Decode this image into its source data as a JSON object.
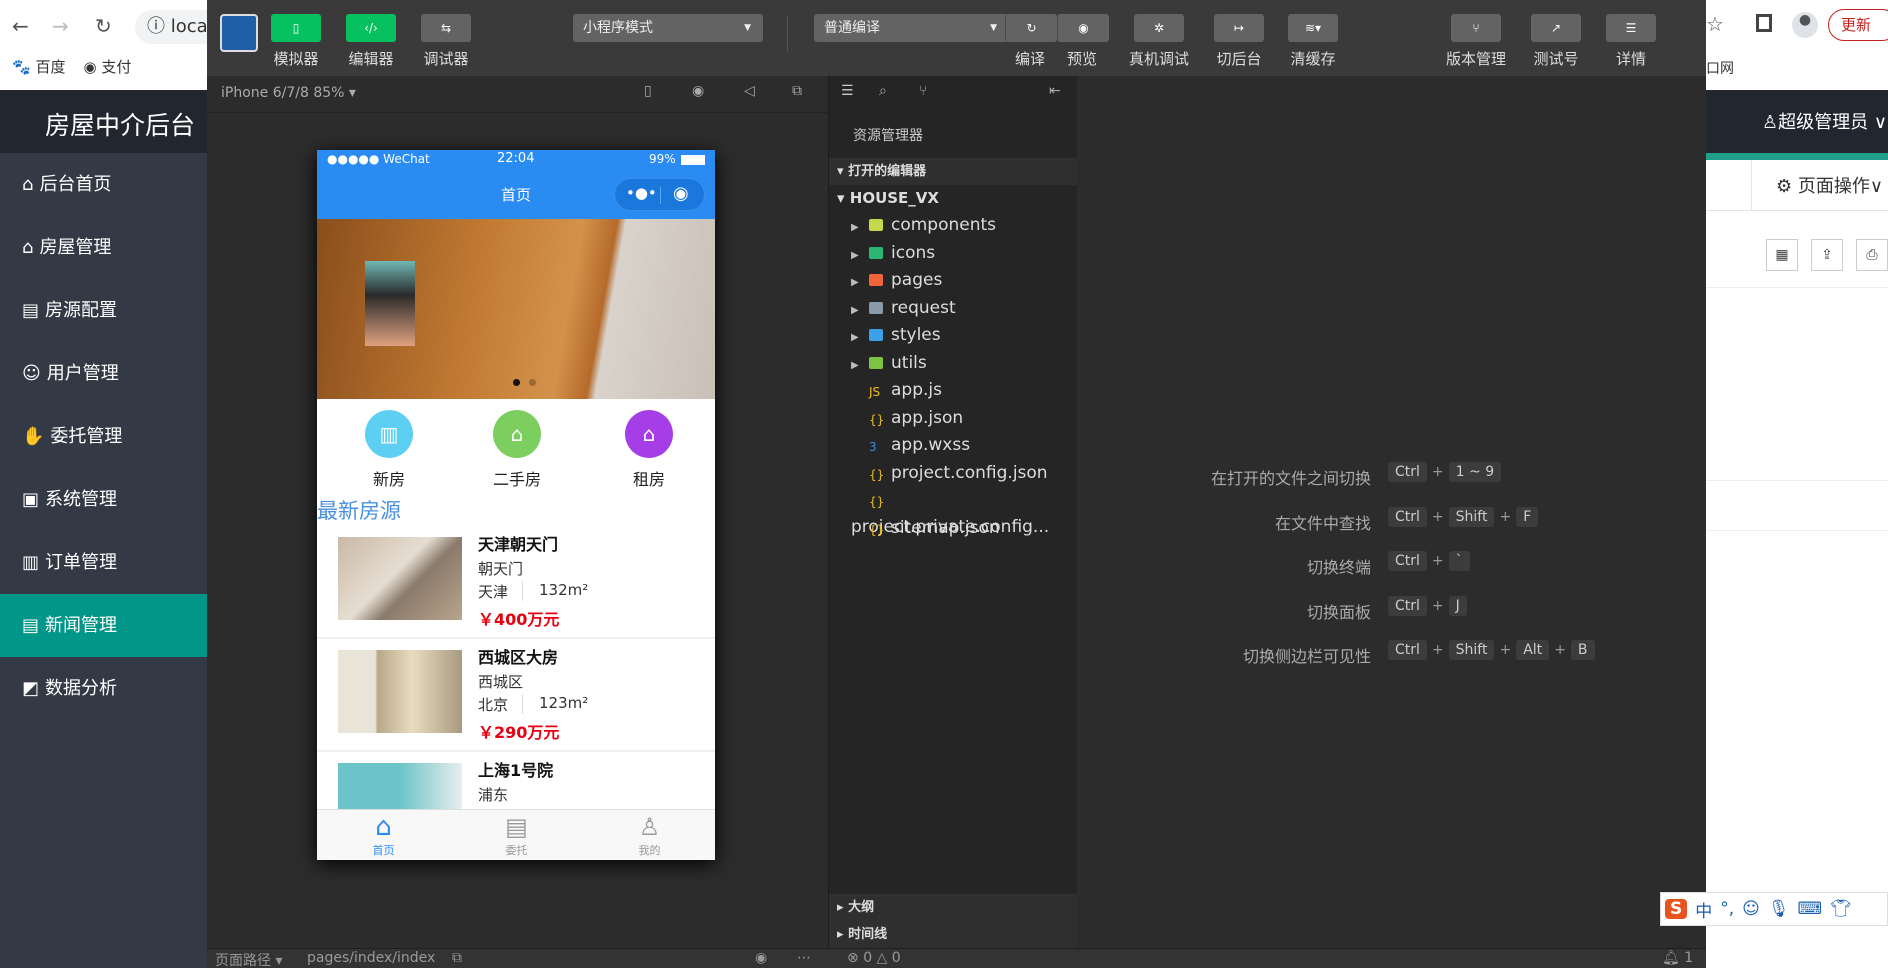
{
  "browser": {
    "url": "loca",
    "bookmarks": [
      "百度",
      "支付"
    ],
    "update_label": "更新",
    "bookmark_right": "口网"
  },
  "admin": {
    "title": "房屋中介后台",
    "user": "超级管理员",
    "page_ops": "页面操作",
    "menu": [
      {
        "label": "后台首页",
        "icon": "home-icon"
      },
      {
        "label": "房屋管理",
        "icon": "house-icon"
      },
      {
        "label": "房源配置",
        "icon": "config-icon"
      },
      {
        "label": "用户管理",
        "icon": "user-icon"
      },
      {
        "label": "委托管理",
        "icon": "delegate-icon"
      },
      {
        "label": "系统管理",
        "icon": "system-icon"
      },
      {
        "label": "订单管理",
        "icon": "order-icon"
      },
      {
        "label": "新闻管理",
        "icon": "news-icon",
        "active": true
      },
      {
        "label": "数据分析",
        "icon": "chart-icon"
      }
    ],
    "accent": "#009688"
  },
  "devtools": {
    "toolbar": {
      "simulator": "模拟器",
      "editor": "编辑器",
      "debugger": "调试器",
      "mode": "小程序模式",
      "compile_mode": "普通编译",
      "compile": "编译",
      "preview": "预览",
      "real_debug": "真机调试",
      "background": "切后台",
      "clear_cache": "清缓存",
      "version": "版本管理",
      "test_id": "测试号",
      "details": "详情"
    },
    "device": "iPhone 6/7/8 85%",
    "explorer": {
      "title": "资源管理器",
      "open_editors": "打开的编辑器",
      "project": "HOUSE_VX",
      "items": [
        {
          "name": "components",
          "type": "folder",
          "color": "#c5d84b"
        },
        {
          "name": "icons",
          "type": "folder",
          "color": "#2bb673"
        },
        {
          "name": "pages",
          "type": "folder",
          "color": "#f0643c"
        },
        {
          "name": "request",
          "type": "folder",
          "color": "#8a9aa8"
        },
        {
          "name": "styles",
          "type": "folder",
          "color": "#3aa0e8"
        },
        {
          "name": "utils",
          "type": "folder",
          "color": "#7cc443"
        },
        {
          "name": "app.js",
          "type": "js",
          "color": "#f0c020"
        },
        {
          "name": "app.json",
          "type": "json",
          "color": "#f0c020"
        },
        {
          "name": "app.wxss",
          "type": "css",
          "color": "#3a8ee8"
        },
        {
          "name": "project.config.json",
          "type": "json",
          "color": "#f0c020"
        },
        {
          "name": "project.private.config...",
          "type": "json",
          "color": "#f0c020"
        },
        {
          "name": "sitemap.json",
          "type": "json",
          "color": "#f0c020"
        }
      ],
      "outline": "大纲",
      "timeline": "时间线"
    },
    "shortcuts": [
      {
        "label": "在打开的文件之间切换",
        "keys": [
          "Ctrl",
          "1 ~ 9"
        ]
      },
      {
        "label": "在文件中查找",
        "keys": [
          "Ctrl",
          "Shift",
          "F"
        ]
      },
      {
        "label": "切换终端",
        "keys": [
          "Ctrl",
          "`"
        ]
      },
      {
        "label": "切换面板",
        "keys": [
          "Ctrl",
          "J"
        ]
      },
      {
        "label": "切换侧边栏可见性",
        "keys": [
          "Ctrl",
          "Shift",
          "Alt",
          "B"
        ]
      }
    ],
    "status": {
      "page_path_label": "页面路径",
      "page_path": "pages/index/index",
      "errors": "0",
      "warnings": "0",
      "notifications": "1"
    }
  },
  "phone": {
    "carrier": "●●●●● WeChat",
    "time": "22:04",
    "battery": "99%",
    "nav_title": "首页",
    "quick": [
      {
        "label": "新房",
        "color": "#5ccff2"
      },
      {
        "label": "二手房",
        "color": "#7ccf5f"
      },
      {
        "label": "租房",
        "color": "#a63ee8"
      }
    ],
    "latest_title": "最新房源",
    "listings": [
      {
        "title": "天津朝天门",
        "area_name": "朝天门",
        "city": "天津",
        "size": "132m²",
        "price": "￥400万元"
      },
      {
        "title": "西城区大房",
        "area_name": "西城区",
        "city": "北京",
        "size": "123m²",
        "price": "￥290万元"
      },
      {
        "title": "上海1号院",
        "area_name": "浦东"
      }
    ],
    "tabs": [
      {
        "label": "首页",
        "active": true
      },
      {
        "label": "委托"
      },
      {
        "label": "我的"
      }
    ],
    "accent": "#2a8cf2",
    "price_color": "#e60012"
  },
  "ime": {
    "labels": [
      "中",
      "°,"
    ]
  }
}
